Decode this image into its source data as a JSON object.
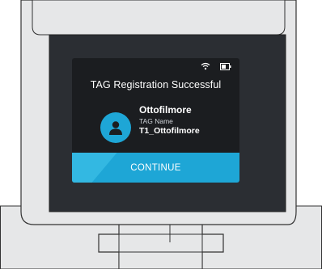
{
  "screen": {
    "title": "TAG Registration Successful",
    "user": {
      "name": "Ottofilmore",
      "tag_label": "TAG Name",
      "tag_value": "T1_Ottofilmore"
    },
    "continue_label": "CONTINUE"
  },
  "status": {
    "wifi_icon": "wifi-icon",
    "battery_icon": "battery-icon"
  },
  "colors": {
    "accent": "#1ea6d6",
    "screen_bg": "#1b1d20",
    "device_frame": "#e6e7e8",
    "outline": "#222222"
  }
}
